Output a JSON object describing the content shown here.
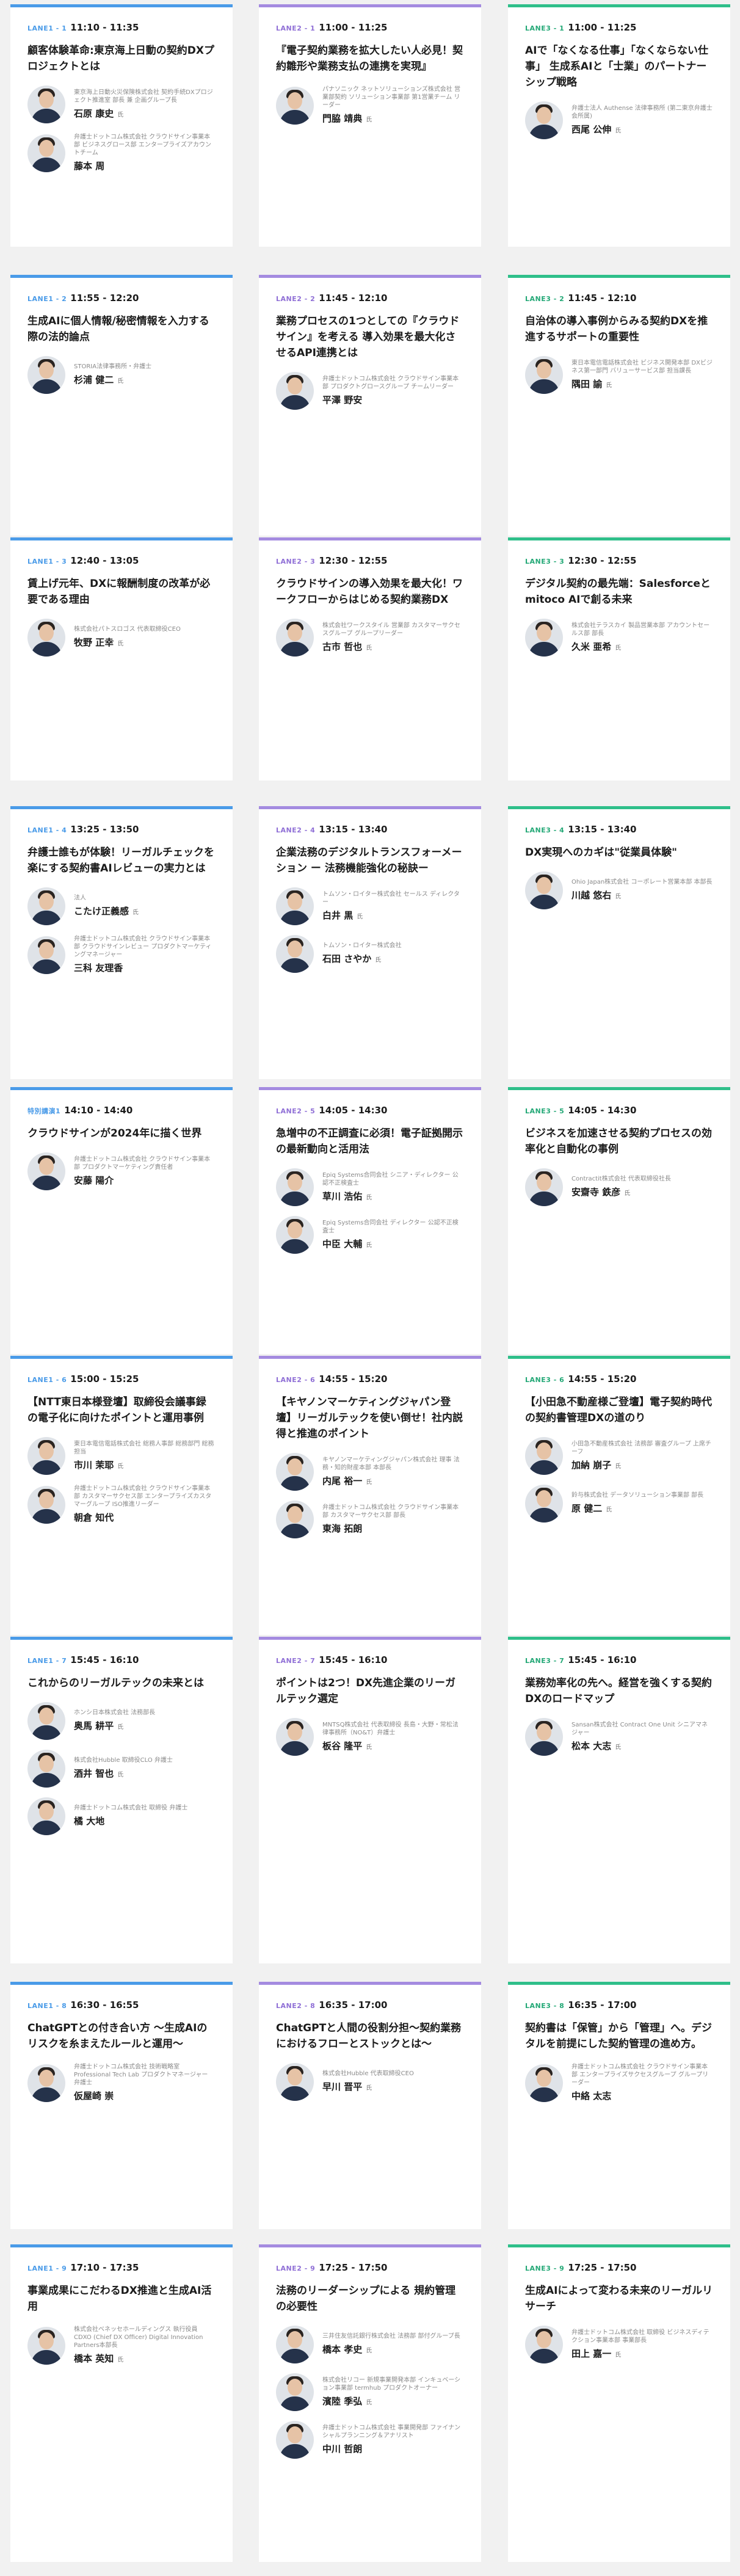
{
  "colors": {
    "lane1": "#4a9be8",
    "lane2": "#a48be0",
    "lane3": "#2fbf8a",
    "background": "#f1f1f1"
  },
  "sessions": [
    {
      "lane": "LANE1 - 1",
      "time": "11:10 - 11:35",
      "title": "顧客体験革命:東京海上日動の契約DXプロジェクトとは",
      "speakers": [
        {
          "org": "東京海上日動火災保険株式会社 契約手続DXプロジェクト推進室 部長 兼 企画グループ長",
          "name": "石原 康史",
          "suffix": "氏"
        },
        {
          "org": "弁護士ドットコム株式会社 クラウドサイン事業本部 ビジネスグロース部 エンタープライズアカウントチーム",
          "name": "藤本 周",
          "suffix": ""
        }
      ]
    },
    {
      "lane": "LANE2 - 1",
      "time": "11:00 - 11:25",
      "title": "『電子契約業務を拡大したい人必見！契約雛形や業務支払の連携を実現』",
      "speakers": [
        {
          "org": "パナソニック ネットソリューションズ株式会社 営業部契約 ソリューション事業部 第1営業チーム リーダー",
          "name": "門脇 靖典",
          "suffix": "氏"
        }
      ]
    },
    {
      "lane": "LANE3 - 1",
      "time": "11:00 - 11:25",
      "title": "AIで「なくなる仕事」「なくならない仕事」 生成系AIと「士業」のパートナーシップ戦略",
      "speakers": [
        {
          "org": "弁護士法人 Authense 法律事務所 (第二東京弁護士会所属)",
          "name": "西尾 公伸",
          "suffix": "氏"
        }
      ]
    },
    {
      "lane": "LANE1 - 2",
      "time": "11:55 - 12:20",
      "title": "生成AIに個人情報/秘密情報を入力する際の法的論点",
      "speakers": [
        {
          "org": "STORIA法律事務所・弁護士",
          "name": "杉浦 健二",
          "suffix": "氏"
        }
      ]
    },
    {
      "lane": "LANE2 - 2",
      "time": "11:45 - 12:10",
      "title": "業務プロセスの1つとしての『クラウドサイン』を考える 導入効果を最大化させるAPI連携とは",
      "speakers": [
        {
          "org": "弁護士ドットコム株式会社 クラウドサイン事業本部 プロダクトグロースグループ チームリーダー",
          "name": "平澤 野安",
          "suffix": ""
        }
      ]
    },
    {
      "lane": "LANE3 - 2",
      "time": "11:45 - 12:10",
      "title": "自治体の導入事例からみる契約DXを推進するサポートの重要性",
      "speakers": [
        {
          "org": "東日本電信電話株式会社 ビジネス開発本部 DXビジネス第一部門 バリューサービス部 担当課長",
          "name": "隅田 諭",
          "suffix": "氏"
        }
      ]
    },
    {
      "lane": "LANE1 - 3",
      "time": "12:40 - 13:05",
      "title": "賃上げ元年、DXに報酬制度の改革が必要である理由",
      "speakers": [
        {
          "org": "株式会社パトスロゴス 代表取締役CEO",
          "name": "牧野 正幸",
          "suffix": "氏"
        }
      ]
    },
    {
      "lane": "LANE2 - 3",
      "time": "12:30 - 12:55",
      "title": "クラウドサインの導入効果を最大化！ワークフローからはじめる契約業務DX",
      "speakers": [
        {
          "org": "株式会社ワークスタイル 営業部 カスタマーサクセスグループ グループリーダー",
          "name": "古市 哲也",
          "suffix": "氏"
        }
      ]
    },
    {
      "lane": "LANE3 - 3",
      "time": "12:30 - 12:55",
      "title": "デジタル契約の最先端：Salesforceとmitoco AIで創る未来",
      "speakers": [
        {
          "org": "株式会社テラスカイ 製品営業本部 アカウントセールス部 部長",
          "name": "久米 亜希",
          "suffix": "氏"
        }
      ]
    },
    {
      "lane": "LANE1 - 4",
      "time": "13:25 - 13:50",
      "title": "弁護士誰もが体験！リーガルチェックを楽にする契約書AIレビューの実力とは",
      "speakers": [
        {
          "org": "法人",
          "name": "こたけ正義感",
          "suffix": "氏"
        },
        {
          "org": "弁護士ドットコム株式会社 クラウドサイン事業本部 クラウドサインレビュー プロダクトマーケティングマネージャー",
          "name": "三科 友理香",
          "suffix": ""
        }
      ]
    },
    {
      "lane": "LANE2 - 4",
      "time": "13:15 - 13:40",
      "title": "企業法務のデジタルトランスフォーメーション ー 法務機能強化の秘訣ー",
      "speakers": [
        {
          "org": "トムソン・ロイター株式会社 セールス ディレクター",
          "name": "白井 黒",
          "suffix": "氏"
        },
        {
          "org": "トムソン・ロイター株式会社",
          "name": "石田 さやか",
          "suffix": "氏"
        }
      ]
    },
    {
      "lane": "LANE3 - 4",
      "time": "13:15 - 13:40",
      "title": "DX実現へのカギは\"従業員体験\"",
      "speakers": [
        {
          "org": "Ohio Japan株式会社 コーポレート営業本部 本部長",
          "name": "川越 悠右",
          "suffix": "氏"
        }
      ]
    },
    {
      "lane": "特別講演1",
      "time": "14:10 - 14:40",
      "title": "クラウドサインが2024年に描く世界",
      "speakers": [
        {
          "org": "弁護士ドットコム株式会社 クラウドサイン事業本部 プロダクトマーケティング責任者",
          "name": "安藤 陽介",
          "suffix": ""
        }
      ]
    },
    {
      "lane": "LANE2 - 5",
      "time": "14:05 - 14:30",
      "title": "急増中の不正調査に必須！電子証拠開示の最新動向と活用法",
      "speakers": [
        {
          "org": "Epiq Systems合同会社 シニア・ディレクター 公認不正検査士",
          "name": "草川 浩佑",
          "suffix": "氏"
        },
        {
          "org": "Epiq Systems合同会社 ディレクター 公認不正検査士",
          "name": "中臣 大輔",
          "suffix": "氏"
        }
      ]
    },
    {
      "lane": "LANE3 - 5",
      "time": "14:05 - 14:30",
      "title": "ビジネスを加速させる契約プロセスの効率化と自動化の事例",
      "speakers": [
        {
          "org": "Contractit株式会社 代表取締役社長",
          "name": "安齋寺 鉄彦",
          "suffix": "氏"
        }
      ]
    },
    {
      "lane": "LANE1 - 6",
      "time": "15:00 - 15:25",
      "title": "【NTT東日本様登壇】取締役会議事録の電子化に向けたポイントと運用事例",
      "speakers": [
        {
          "org": "東日本電信電話株式会社 総務人事部 総務部門 総務担当",
          "name": "市川 茉耶",
          "suffix": "氏"
        },
        {
          "org": "弁護士ドットコム株式会社 クラウドサイン事業本部 カスタマーサクセス部 エンタープライズカスタマーグループ ISO推進リーダー",
          "name": "朝倉 知代",
          "suffix": ""
        }
      ]
    },
    {
      "lane": "LANE2 - 6",
      "time": "14:55 - 15:20",
      "title": "【キヤノンマーケティングジャパン登壇】リーガルテックを使い倒せ！社内説得と推進のポイント",
      "speakers": [
        {
          "org": "キヤノンマーケティングジャパン株式会社 理事 法務・知的財産本部 本部長",
          "name": "内尾 裕一",
          "suffix": "氏"
        },
        {
          "org": "弁護士ドットコム株式会社 クラウドサイン事業本部 カスタマーサクセス部 部長",
          "name": "東海 拓朗",
          "suffix": ""
        }
      ]
    },
    {
      "lane": "LANE3 - 6",
      "time": "14:55 - 15:20",
      "title": "【小田急不動産様ご登壇】電子契約時代の契約書管理DXの道のり",
      "speakers": [
        {
          "org": "小田急不動産株式会社 法務部 審査グループ 上席チーフ",
          "name": "加納 崩子",
          "suffix": "氏"
        },
        {
          "org": "鈴与株式会社 データソリューション事業部 部長",
          "name": "原 健二",
          "suffix": "氏"
        }
      ]
    },
    {
      "lane": "LANE1 - 7",
      "time": "15:45 - 16:10",
      "title": "これからのリーガルテックの未来とは",
      "speakers": [
        {
          "org": "ホンシ日本株式会社 法務部長",
          "name": "奥馬 耕平",
          "suffix": "氏"
        },
        {
          "org": "株式会社Hubble 取締役CLO 弁護士",
          "name": "酒井 智也",
          "suffix": "氏"
        },
        {
          "org": "弁護士ドットコム株式会社 取締役 弁護士",
          "name": "橘 大地",
          "suffix": ""
        }
      ]
    },
    {
      "lane": "LANE2 - 7",
      "time": "15:45 - 16:10",
      "title": "ポイントは2つ！DX先進企業のリーガルテック選定",
      "speakers": [
        {
          "org": "MNTSQ株式会社 代表取締役 長島・大野・常松法律事務所（NO&T）弁護士",
          "name": "板谷 隆平",
          "suffix": "氏"
        }
      ]
    },
    {
      "lane": "LANE3 - 7",
      "time": "15:45 - 16:10",
      "title": "業務効率化の先へ。経営を強くする契約DXのロードマップ",
      "speakers": [
        {
          "org": "Sansan株式会社 Contract One Unit シニアマネジャー",
          "name": "松本 大志",
          "suffix": "氏"
        }
      ]
    },
    {
      "lane": "LANE1 - 8",
      "time": "16:30 - 16:55",
      "title": "ChatGPTとの付き合い方 〜生成AIのリスクを糸まえたルールと運用〜",
      "speakers": [
        {
          "org": "弁護士ドットコム株式会社 技術戦略室 Professional Tech Lab プロダクトマネージャー 弁護士",
          "name": "仮屋崎 崇",
          "suffix": ""
        }
      ]
    },
    {
      "lane": "LANE2 - 8",
      "time": "16:35 - 17:00",
      "title": "ChatGPTと人間の役割分担〜契約業務におけるフローとストックとは〜",
      "speakers": [
        {
          "org": "株式会社Hubble 代表取締役CEO",
          "name": "早川 晋平",
          "suffix": "氏"
        }
      ]
    },
    {
      "lane": "LANE3 - 8",
      "time": "16:35 - 17:00",
      "title": "契約書は「保管」から「管理」へ。デジタルを前提にした契約管理の進め方。",
      "speakers": [
        {
          "org": "弁護士ドットコム株式会社 クラウドサイン事業本部 エンタープライズサクセスグループ グループリーダー",
          "name": "中絡 太志",
          "suffix": ""
        }
      ]
    },
    {
      "lane": "LANE1 - 9",
      "time": "17:10 - 17:35",
      "title": "事業成果にこだわるDX推進と生成AI活用",
      "speakers": [
        {
          "org": "株式会社ベネッセホールディングス 執行役員 CDXO (Chief DX Officer) Digital Innovation Partners本部長",
          "name": "橋本 英知",
          "suffix": "氏"
        }
      ]
    },
    {
      "lane": "LANE2 - 9",
      "time": "17:25 - 17:50",
      "title": "法務のリーダーシップによる 規約管理の必要性",
      "speakers": [
        {
          "org": "三井住友信託銀行株式会社 法務部 部付グループ長",
          "name": "橋本 孝史",
          "suffix": "氏"
        },
        {
          "org": "株式会社リコー 新規事業開発本部 インキュベーション事業部 termhub プロダクトオーナー",
          "name": "濱陸 季弘",
          "suffix": "氏"
        },
        {
          "org": "弁護士ドットコム株式会社 事業開発部 ファイナンシャルプランニング＆アナリスト",
          "name": "中川 哲朗",
          "suffix": ""
        }
      ]
    },
    {
      "lane": "LANE3 - 9",
      "time": "17:25 - 17:50",
      "title": "生成AIによって変わる未来のリーガルリサーチ",
      "speakers": [
        {
          "org": "弁護士ドットコム株式会社 取締役 ビジネスディテクション事業本部 事業部長",
          "name": "田上 嘉一",
          "suffix": "氏"
        }
      ]
    }
  ]
}
